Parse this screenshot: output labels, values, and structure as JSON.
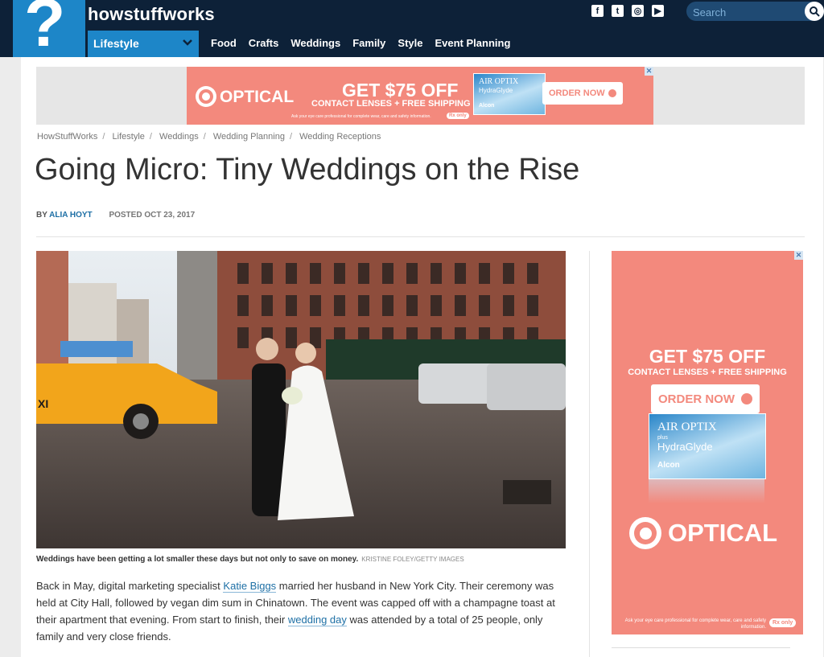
{
  "header": {
    "logo_glyph": "?",
    "brand": "howstuffworks",
    "social": [
      {
        "name": "facebook-icon",
        "glyph": "f"
      },
      {
        "name": "twitter-icon",
        "glyph": "t"
      },
      {
        "name": "instagram-icon",
        "glyph": "◎"
      },
      {
        "name": "youtube-icon",
        "glyph": "▶"
      }
    ],
    "search_placeholder": "Search"
  },
  "nav": {
    "section_label": "Lifestyle",
    "items": [
      "Food",
      "Crafts",
      "Weddings",
      "Family",
      "Style",
      "Event Planning"
    ]
  },
  "ad_top": {
    "brand": "OPTICAL",
    "headline": "GET $75 OFF",
    "subline": "CONTACT LENSES + FREE SHIPPING",
    "fine_print": "Ask your eye care professional for complete wear, care and safety information.",
    "rx": "Rx only",
    "product_line1": "AIR OPTIX",
    "product_line2": "HydraGlyde",
    "product_maker": "Alcon",
    "cta": "ORDER NOW",
    "close": "✕"
  },
  "breadcrumb": [
    "HowStuffWorks",
    "Lifestyle",
    "Weddings",
    "Wedding Planning",
    "Wedding Receptions"
  ],
  "article": {
    "title": "Going Micro: Tiny Weddings on the Rise",
    "by_label": "BY",
    "author": "ALIA HOYT",
    "posted": "POSTED OCT 23, 2017",
    "taxi_label": "XI",
    "caption": "Weddings have been getting a lot smaller these days but not only to save on money.",
    "credit": "KRISTINE FOLEY/GETTY IMAGES",
    "p1_a": "Back in May, digital marketing specialist ",
    "p1_link1": "Katie Biggs",
    "p1_b": " married her husband in New York City. Their ceremony was held at City Hall, followed by vegan dim sum in Chinatown. The event was capped off with a champagne toast at their apartment that evening. From start to finish, their ",
    "p1_link2": "wedding day",
    "p1_c": " was attended by a total of 25 people, only family and very close friends."
  },
  "ad_side": {
    "headline": "GET $75 OFF",
    "subline": "CONTACT LENSES + FREE SHIPPING",
    "cta": "ORDER NOW",
    "product_line1": "AIR OPTIX",
    "product_line1b": "plus",
    "product_line2": "HydraGlyde",
    "product_maker": "Alcon",
    "brand": "OPTICAL",
    "fine_print": "Ask your eye care professional for complete wear, care and safety information.",
    "rx": "Rx only",
    "close": "✕"
  },
  "colors": {
    "header_bg": "#0d2138",
    "accent_blue": "#1d86c8",
    "ad_salmon": "#f3897d",
    "link": "#1d6fa5"
  }
}
